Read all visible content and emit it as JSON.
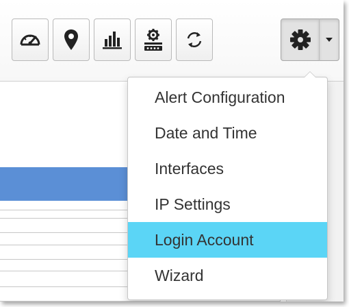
{
  "toolbar": {
    "buttons": [
      {
        "icon": "dashboard-gauge-icon"
      },
      {
        "icon": "map-pin-icon"
      },
      {
        "icon": "bar-chart-icon"
      },
      {
        "icon": "network-device-icon"
      },
      {
        "icon": "refresh-icon"
      },
      {
        "icon": "settings-gear-icon"
      }
    ],
    "caret_icon": "caret-down-icon"
  },
  "settings_menu": {
    "items": [
      {
        "label": "Alert Configuration"
      },
      {
        "label": "Date and Time"
      },
      {
        "label": "Interfaces"
      },
      {
        "label": "IP Settings"
      },
      {
        "label": "Login Account",
        "highlighted": true
      },
      {
        "label": "Wizard"
      }
    ]
  },
  "colors": {
    "highlight": "#5bd5f6",
    "band": "#5b8fd6",
    "text": "#333333"
  }
}
